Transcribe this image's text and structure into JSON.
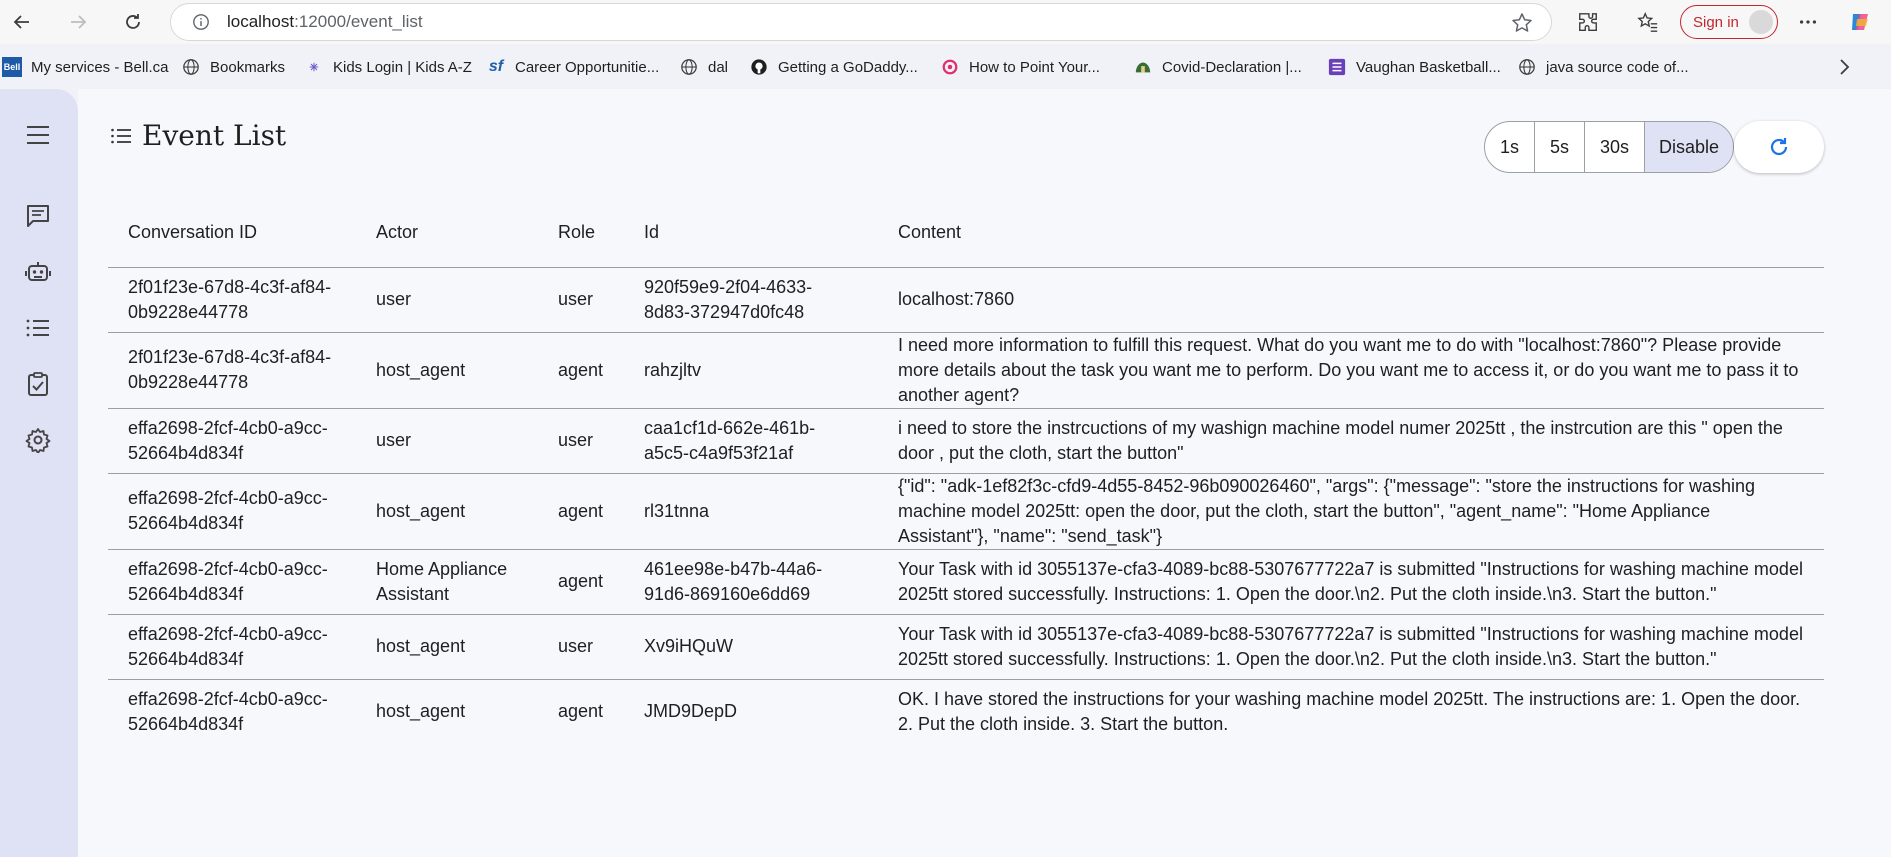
{
  "browser": {
    "url_host": "localhost",
    "url_rest": ":12000/event_list",
    "signin_label": "Sign in"
  },
  "bookmarks": [
    {
      "label": "My services - Bell.ca",
      "icon": "bell-icon"
    },
    {
      "label": "Bookmarks",
      "icon": "globe-icon"
    },
    {
      "label": "Kids Login | Kids A-Z",
      "icon": "kids-az-icon"
    },
    {
      "label": "Career Opportunitie...",
      "icon": "sf-icon"
    },
    {
      "label": "dal",
      "icon": "globe-icon"
    },
    {
      "label": "Getting a GoDaddy...",
      "icon": "github-icon"
    },
    {
      "label": "How to Point Your...",
      "icon": "swirl-icon"
    },
    {
      "label": "Covid-Declaration |...",
      "icon": "school-icon"
    },
    {
      "label": "Vaughan Basketball...",
      "icon": "list-icon"
    },
    {
      "label": "java source code of...",
      "icon": "globe-icon"
    }
  ],
  "page": {
    "title": "Event List",
    "refresh_options": [
      "1s",
      "5s",
      "30s",
      "Disable"
    ],
    "selected_refresh": "Disable"
  },
  "table": {
    "headers": [
      "Conversation ID",
      "Actor",
      "Role",
      "Id",
      "Content"
    ],
    "rows": [
      {
        "conversation_id": "2f01f23e-67d8-4c3f-af84-0b9228e44778",
        "actor": "user",
        "role": "user",
        "id": "920f59e9-2f04-4633-8d83-372947d0fc48",
        "content": "localhost:7860"
      },
      {
        "conversation_id": "2f01f23e-67d8-4c3f-af84-0b9228e44778",
        "actor": "host_agent",
        "role": "agent",
        "id": "rahzjltv",
        "content": "I need more information to fulfill this request. What do you want me to do with \"localhost:7860\"? Please provide more details about the task you want me to perform. Do you want me to access it, or do you want me to pass it to another agent?"
      },
      {
        "conversation_id": "effa2698-2fcf-4cb0-a9cc-52664b4d834f",
        "actor": "user",
        "role": "user",
        "id": "caa1cf1d-662e-461b-a5c5-c4a9f53f21af",
        "content": "i need to store the instrcuctions of my washign machine model numer 2025tt , the instrcution are this \" open the door , put the cloth, start the button\""
      },
      {
        "conversation_id": "effa2698-2fcf-4cb0-a9cc-52664b4d834f",
        "actor": "host_agent",
        "role": "agent",
        "id": "rl31tnna",
        "content": "{\"id\": \"adk-1ef82f3c-cfd9-4d55-8452-96b090026460\", \"args\": {\"message\": \"store the instructions for washing machine model 2025tt: open the door, put the cloth, start the button\", \"agent_name\": \"Home Appliance Assistant\"}, \"name\": \"send_task\"}"
      },
      {
        "conversation_id": "effa2698-2fcf-4cb0-a9cc-52664b4d834f",
        "actor": "Home Appliance Assistant",
        "role": "agent",
        "id": "461ee98e-b47b-44a6-91d6-869160e6dd69",
        "content": "Your Task with id 3055137e-cfa3-4089-bc88-5307677722a7 is submitted \"Instructions for washing machine model 2025tt stored successfully. Instructions: 1. Open the door.\\n2. Put the cloth inside.\\n3. Start the button.\""
      },
      {
        "conversation_id": "effa2698-2fcf-4cb0-a9cc-52664b4d834f",
        "actor": "host_agent",
        "role": "user",
        "id": "Xv9iHQuW",
        "content": "Your Task with id 3055137e-cfa3-4089-bc88-5307677722a7 is submitted \"Instructions for washing machine model 2025tt stored successfully. Instructions: 1. Open the door.\\n2. Put the cloth inside.\\n3. Start the button.\""
      },
      {
        "conversation_id": "effa2698-2fcf-4cb0-a9cc-52664b4d834f",
        "actor": "host_agent",
        "role": "agent",
        "id": "JMD9DepD",
        "content": "OK. I have stored the instructions for your washing machine model 2025tt. The instructions are: 1. Open the door. 2. Put the cloth inside. 3. Start the button."
      }
    ]
  },
  "colors": {
    "sidebar": "#dfe1f5",
    "selected_option": "#dfe1f5",
    "accent": "#1a73e8",
    "signin": "#c4262e"
  }
}
